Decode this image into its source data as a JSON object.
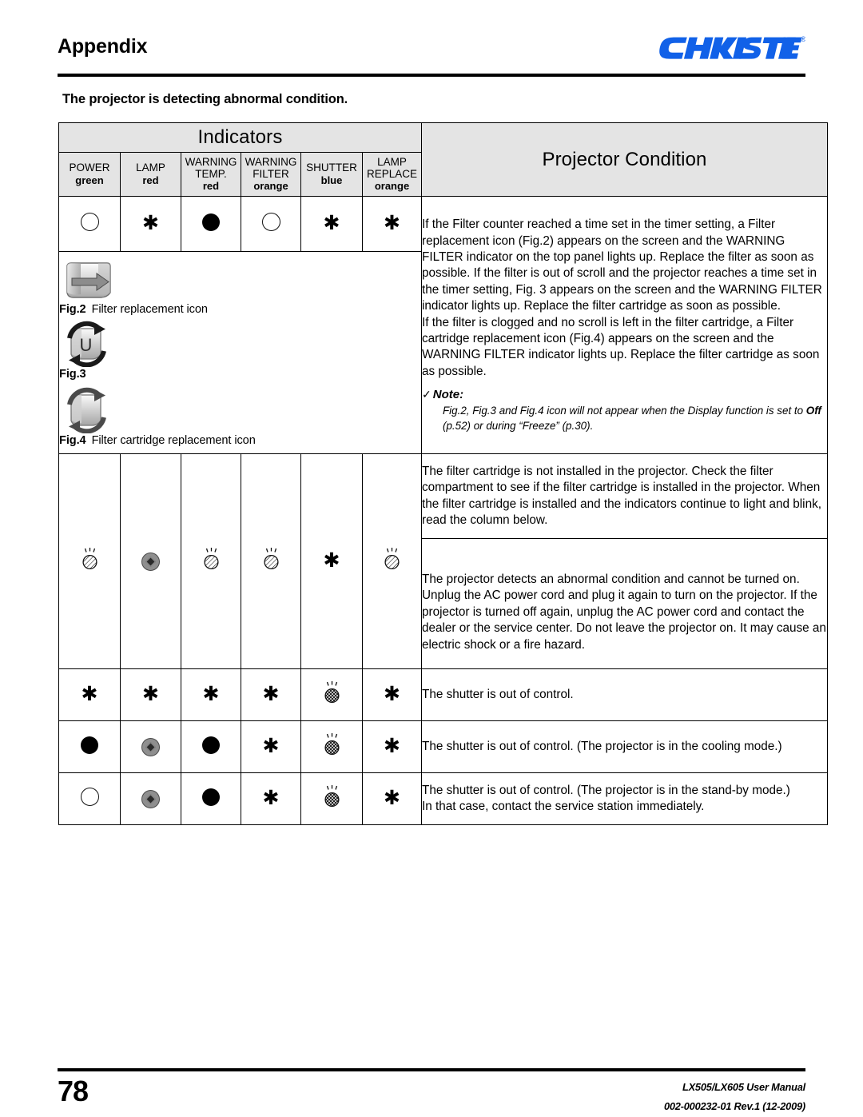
{
  "header": {
    "title": "Appendix",
    "logo_text": "CHRISTIE",
    "logo_registered": "®",
    "logo_color": "#1161e8"
  },
  "subtitle": "The projector is detecting abnormal condition.",
  "table": {
    "indicators_header": "Indicators",
    "condition_header": "Projector Condition",
    "columns": [
      {
        "name": "POWER",
        "color_label": "green"
      },
      {
        "name": "LAMP",
        "color_label": "red"
      },
      {
        "name": "WARNING TEMP.",
        "color_label": "red"
      },
      {
        "name": "WARNING FILTER",
        "color_label": "orange"
      },
      {
        "name": "SHUTTER",
        "color_label": "blue"
      },
      {
        "name": "LAMP REPLACE",
        "color_label": "orange"
      }
    ],
    "rows": [
      {
        "indicators": [
          "off",
          "any",
          "on",
          "off",
          "any",
          "any"
        ],
        "condition_paragraphs": [
          "If the Filter counter reached a time set in the timer setting, a Filter replacement icon (Fig.2) appears on the screen and the WARNING FILTER indicator on the top panel lights up. Replace the filter as soon as possible. If the filter is out of scroll and the projector reaches a time set in the timer setting, Fig. 3 appears on the screen and the WARNING FILTER indicator lights up. Replace the filter cartridge as soon as possible.",
          "If the filter is clogged and no scroll is left in the filter cartridge, a Filter cartridge replacement icon (Fig.4) appears on the screen and the WARNING FILTER indicator lights up. Replace the filter cartridge as soon as possible."
        ],
        "note": {
          "check": "✓",
          "label": "Note:",
          "text_a": "Fig.2, Fig.3 and Fig.4 icon will not appear when the Display function is set to ",
          "bold": "Off",
          "text_b": " (p.52) or during “Freeze” (p.30)."
        }
      },
      {
        "indicators": [
          "blink",
          "dim",
          "blink",
          "blink",
          "any",
          "blink"
        ],
        "condition_paragraphs": [
          "The filter cartridge is not installed in the projector. Check the filter compartment to see if the filter cartridge is installed in the projector. When the filter cartridge is installed and the indicators continue to light and blink, read the column below."
        ]
      },
      {
        "indicators": [],
        "condition_paragraphs": [
          "The projector detects an abnormal condition and cannot be turned on. Unplug the AC power cord and plug it again to turn on the projector. If the projector is turned off again, unplug the AC power cord and contact the dealer or the service center. Do not leave the projector on. It may cause an electric shock or a fire hazard."
        ]
      },
      {
        "indicators": [
          "any",
          "any",
          "any",
          "any",
          "blink2",
          "any"
        ],
        "condition_paragraphs": [
          "The shutter is out of control."
        ]
      },
      {
        "indicators": [
          "on",
          "dim",
          "on",
          "any",
          "blink2",
          "any"
        ],
        "condition_paragraphs": [
          "The shutter is out of control. (The projector is in the cooling mode.)"
        ]
      },
      {
        "indicators": [
          "off",
          "dim",
          "on",
          "any",
          "blink2",
          "any"
        ],
        "condition_paragraphs": [
          "The shutter is out of control. (The projector is in the stand-by mode.)",
          "In that case, contact the service station immediately."
        ]
      }
    ],
    "figures": [
      {
        "id": "Fig.2",
        "caption": "Filter replacement icon",
        "icon": "filter-replacement-icon"
      },
      {
        "id": "Fig.3",
        "caption": "",
        "icon": "filter-scroll-replacement-icon"
      },
      {
        "id": "Fig.4",
        "caption": "Filter cartridge replacement icon",
        "icon": "filter-cartridge-replacement-icon"
      }
    ]
  },
  "footer": {
    "page_number": "78",
    "manual": "LX505/LX605 User Manual",
    "doc_number": "002-000232-01 Rev.1 (12-2009)"
  }
}
